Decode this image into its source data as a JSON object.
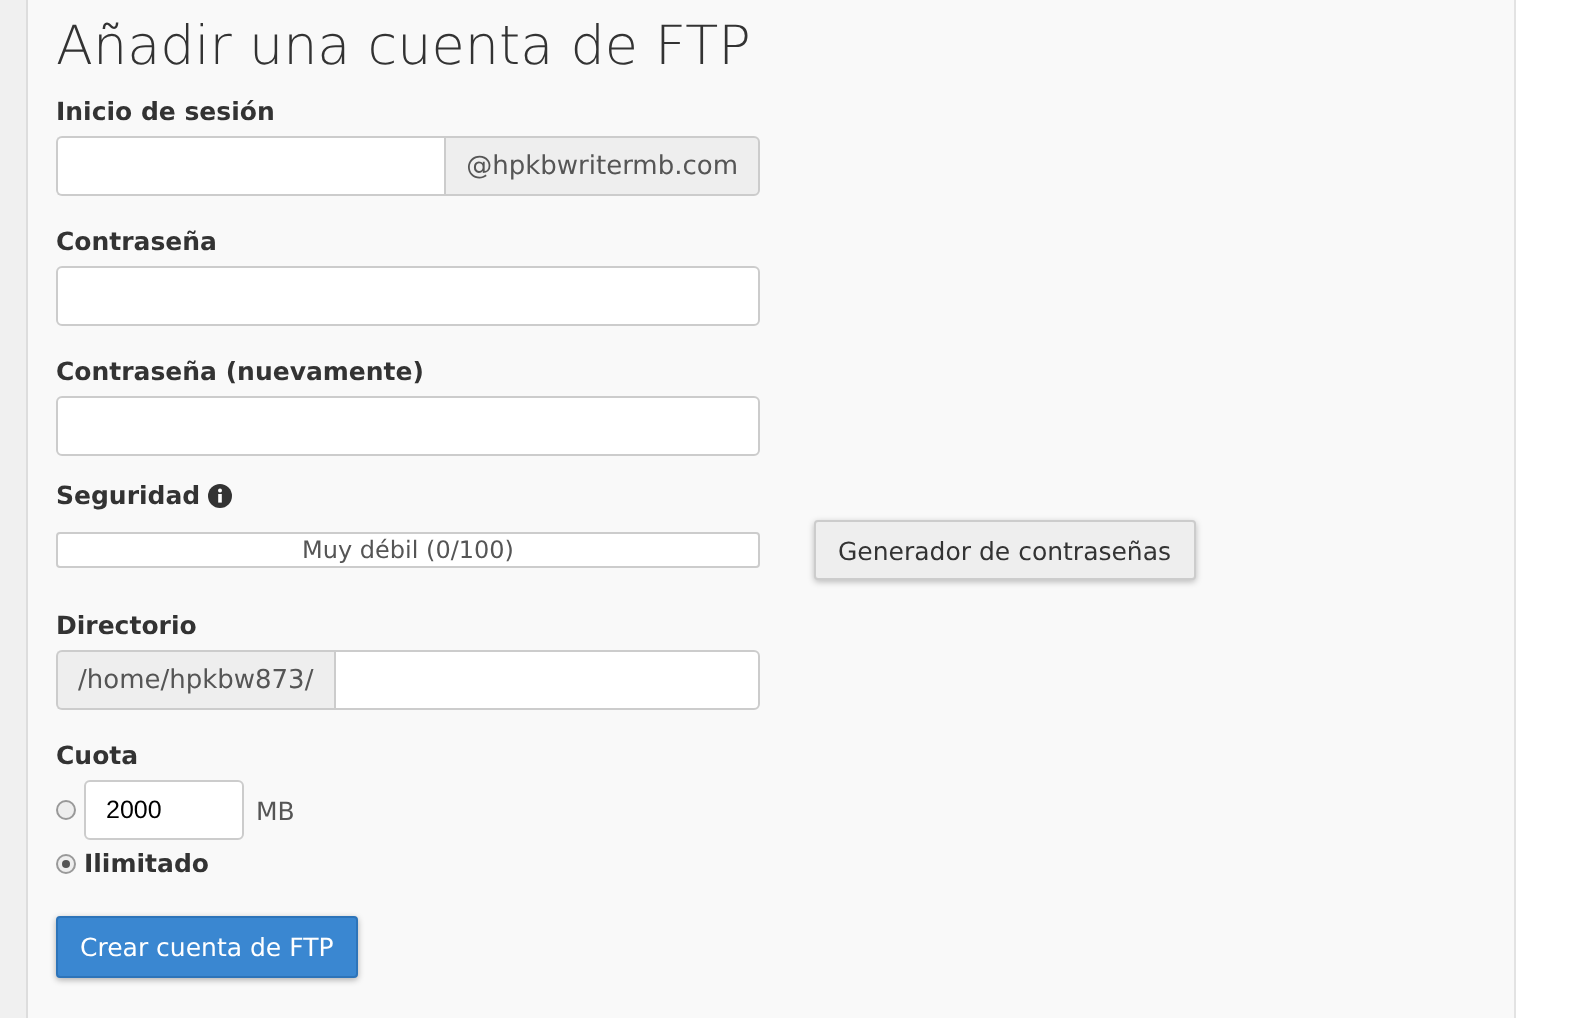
{
  "title": "Añadir una cuenta de FTP",
  "login": {
    "label": "Inicio de sesión",
    "suffix": "@hpkbwritermb.com"
  },
  "password": {
    "label": "Contraseña"
  },
  "password_again": {
    "label": "Contraseña (nuevamente)"
  },
  "security": {
    "label": "Seguridad",
    "level": 0,
    "reading": "Muy débil (0/100)",
    "generator_button": "Generador de contraseñas"
  },
  "directory": {
    "label": "Directorio",
    "prefix": "/home/hpkbw873/"
  },
  "quota": {
    "label": "Cuota",
    "options": [
      {
        "kind": "amount",
        "selected": false,
        "value": "2000",
        "unit": "MB"
      },
      {
        "kind": "unlimited",
        "selected": true,
        "label": "Ilimitado"
      }
    ]
  },
  "submit_button": "Crear cuenta de FTP"
}
